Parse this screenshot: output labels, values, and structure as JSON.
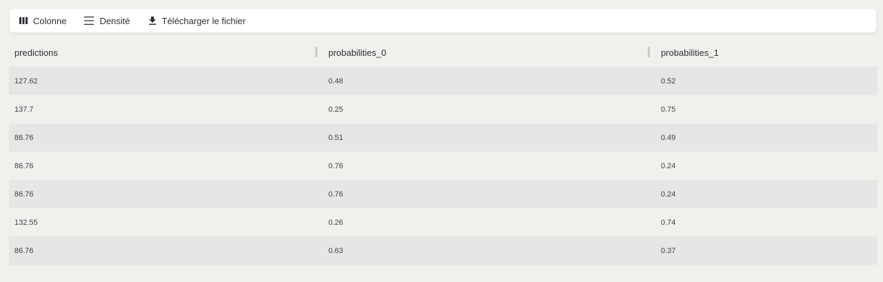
{
  "toolbar": {
    "columns_label": "Colonne",
    "density_label": "Densité",
    "download_label": "Télécharger le fichier"
  },
  "table": {
    "headers": [
      "predictions",
      "probabilities_0",
      "probabilities_1"
    ],
    "rows": [
      [
        "127.62",
        "0.48",
        "0.52"
      ],
      [
        "137.7",
        "0.25",
        "0.75"
      ],
      [
        "86.76",
        "0.51",
        "0.49"
      ],
      [
        "86.76",
        "0.76",
        "0.24"
      ],
      [
        "86.76",
        "0.76",
        "0.24"
      ],
      [
        "132.55",
        "0.26",
        "0.74"
      ],
      [
        "86.76",
        "0.63",
        "0.37"
      ]
    ]
  }
}
